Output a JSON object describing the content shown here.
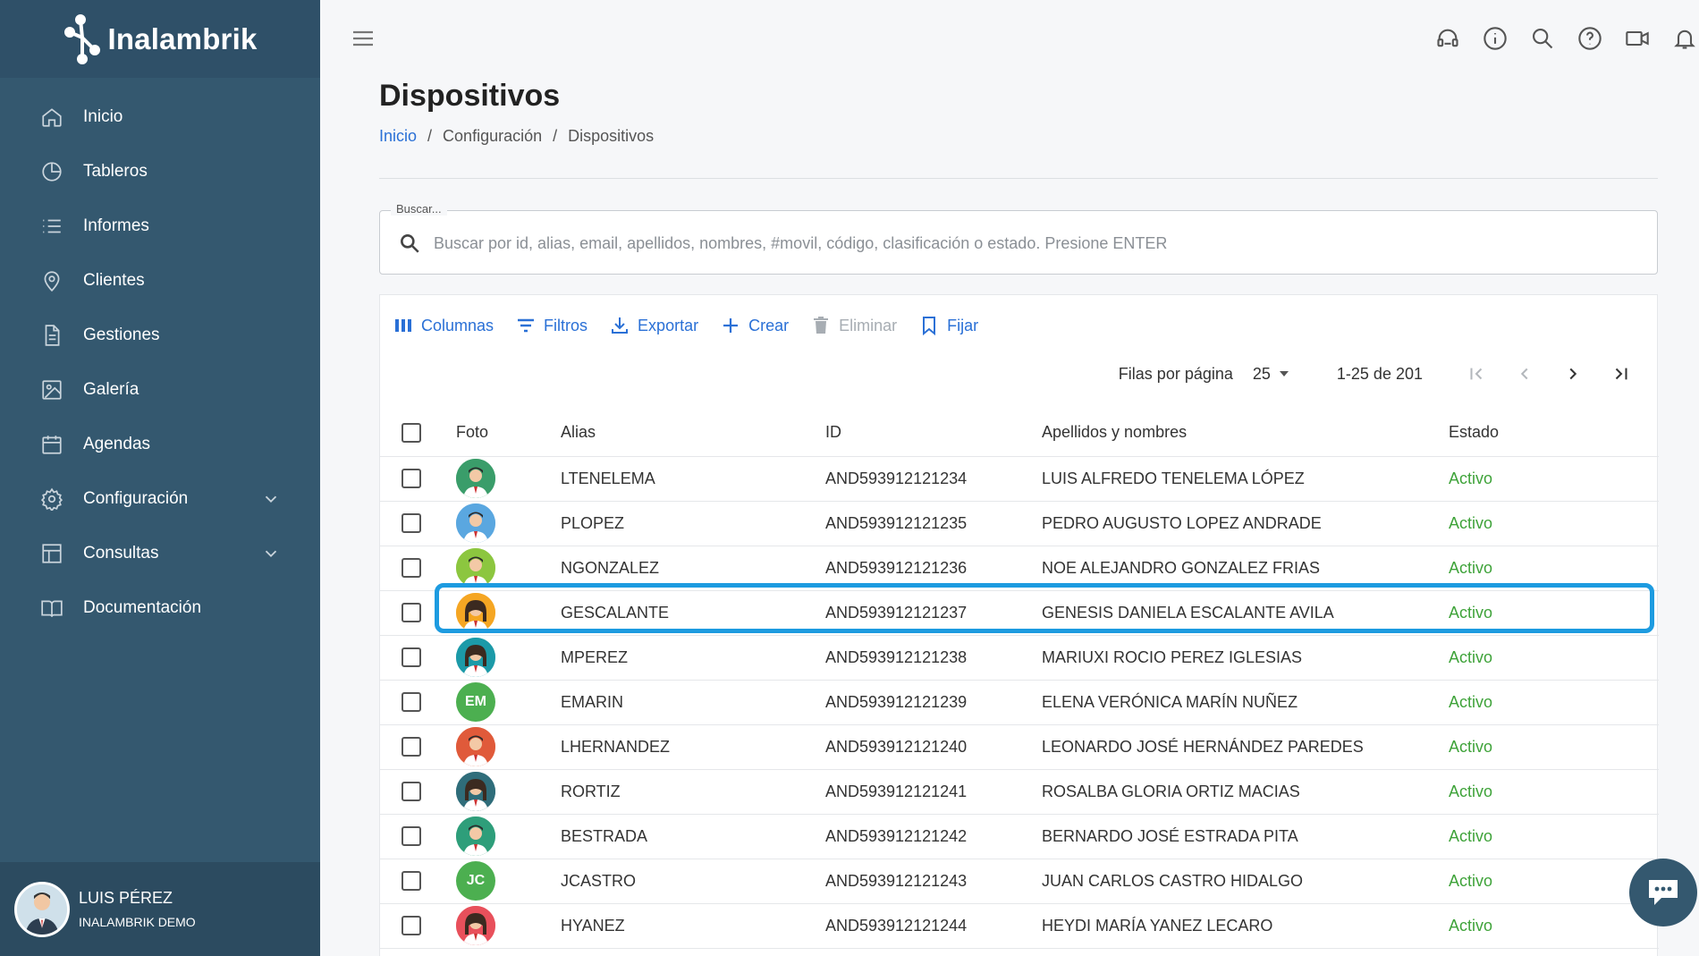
{
  "app": {
    "logo_text": "Inalambrik"
  },
  "sidebar": {
    "items": [
      {
        "label": "Inicio",
        "icon": "home-icon"
      },
      {
        "label": "Tableros",
        "icon": "pie-chart-icon"
      },
      {
        "label": "Informes",
        "icon": "list-icon"
      },
      {
        "label": "Clientes",
        "icon": "location-pin-icon"
      },
      {
        "label": "Gestiones",
        "icon": "document-icon"
      },
      {
        "label": "Galería",
        "icon": "image-icon"
      },
      {
        "label": "Agendas",
        "icon": "calendar-icon"
      },
      {
        "label": "Configuración",
        "icon": "gear-icon"
      },
      {
        "label": "Consultas",
        "icon": "table-icon"
      },
      {
        "label": "Documentación",
        "icon": "book-icon"
      }
    ],
    "user": {
      "name": "LUIS PÉREZ",
      "org": "INALAMBRIK DEMO"
    }
  },
  "topbar": {
    "icons": [
      "support-headset-icon",
      "info-icon",
      "search-icon",
      "help-icon",
      "video-icon",
      "bell-icon"
    ]
  },
  "page": {
    "title": "Dispositivos",
    "breadcrumb": [
      "Inicio",
      "Configuración",
      "Dispositivos"
    ]
  },
  "search": {
    "legend": "Buscar...",
    "placeholder": "Buscar por id, alias, email, apellidos, nombres, #movil, código, clasificación o estado. Presione ENTER"
  },
  "toolbar": {
    "columns": "Columnas",
    "filters": "Filtros",
    "export": "Exportar",
    "create": "Crear",
    "delete": "Eliminar",
    "pin": "Fijar"
  },
  "pager": {
    "rows_label": "Filas por página",
    "rows_value": "25",
    "range": "1-25 de 201"
  },
  "table": {
    "headers": {
      "foto": "Foto",
      "alias": "Alias",
      "id": "ID",
      "name": "Apellidos y nombres",
      "status": "Estado"
    },
    "rows": [
      {
        "alias": "LTENELEMA",
        "id": "AND593912121234",
        "name": "LUIS ALFREDO TENELEMA LÓPEZ",
        "status": "Activo",
        "avatar": "man-avatar",
        "avatar_bg": "#3a9d6a",
        "initials": ""
      },
      {
        "alias": "PLOPEZ",
        "id": "AND593912121235",
        "name": "PEDRO AUGUSTO LOPEZ ANDRADE",
        "status": "Activo",
        "avatar": "man-avatar",
        "avatar_bg": "#5aa7e0",
        "initials": ""
      },
      {
        "alias": "NGONZALEZ",
        "id": "AND593912121236",
        "name": "NOE ALEJANDRO GONZALEZ FRIAS",
        "status": "Activo",
        "avatar": "man-avatar",
        "avatar_bg": "#8cc63f",
        "initials": ""
      },
      {
        "alias": "GESCALANTE",
        "id": "AND593912121237",
        "name": "GENESIS DANIELA ESCALANTE AVILA",
        "status": "Activo",
        "avatar": "woman-avatar",
        "avatar_bg": "#f5a623",
        "initials": ""
      },
      {
        "alias": "MPEREZ",
        "id": "AND593912121238",
        "name": "MARIUXI ROCIO PEREZ IGLESIAS",
        "status": "Activo",
        "avatar": "woman-avatar",
        "avatar_bg": "#1c9aa8",
        "initials": ""
      },
      {
        "alias": "EMARIN",
        "id": "AND593912121239",
        "name": "ELENA VERÓNICA MARÍN NUÑEZ",
        "status": "Activo",
        "avatar": "initials-avatar",
        "avatar_bg": "#4caf50",
        "initials": "EM"
      },
      {
        "alias": "LHERNANDEZ",
        "id": "AND593912121240",
        "name": "LEONARDO JOSÉ HERNÁNDEZ PAREDES",
        "status": "Activo",
        "avatar": "man-avatar",
        "avatar_bg": "#e05a3a",
        "initials": ""
      },
      {
        "alias": "RORTIZ",
        "id": "AND593912121241",
        "name": "ROSALBA GLORIA ORTIZ MACIAS",
        "status": "Activo",
        "avatar": "woman-avatar",
        "avatar_bg": "#2f6d7a",
        "initials": ""
      },
      {
        "alias": "BESTRADA",
        "id": "AND593912121242",
        "name": "BERNARDO JOSÉ ESTRADA PITA",
        "status": "Activo",
        "avatar": "man-avatar",
        "avatar_bg": "#2e9e7a",
        "initials": ""
      },
      {
        "alias": "JCASTRO",
        "id": "AND593912121243",
        "name": "JUAN CARLOS CASTRO HIDALGO",
        "status": "Activo",
        "avatar": "initials-avatar",
        "avatar_bg": "#4caf50",
        "initials": "JC"
      },
      {
        "alias": "HYANEZ",
        "id": "AND593912121244",
        "name": "HEYDI MARÍA YANEZ LECARO",
        "status": "Activo",
        "avatar": "woman-avatar",
        "avatar_bg": "#e8505b",
        "initials": ""
      }
    ],
    "selected_row": 3
  },
  "colors": {
    "sidebar": "#34586f",
    "link": "#2a70d6",
    "status_active": "#3fa33a",
    "highlight": "#1d9be0"
  }
}
